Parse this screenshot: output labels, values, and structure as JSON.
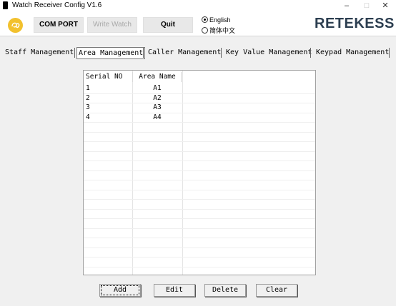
{
  "window": {
    "title": "Watch Receiver Config V1.6",
    "minimize": "–",
    "maximize": "□",
    "close": "✕"
  },
  "toolbar": {
    "com_port": "COM PORT",
    "write_watch": "Write Watch",
    "quit": "Quit",
    "language_options": [
      {
        "label": "English",
        "selected": true
      },
      {
        "label": "简体中文",
        "selected": false
      }
    ],
    "brand": "RETEKESS"
  },
  "tabs": [
    {
      "label": "Staff Management",
      "active": false
    },
    {
      "label": "Area Management",
      "active": true
    },
    {
      "label": "Caller Management",
      "active": false
    },
    {
      "label": "Key Value Management",
      "active": false
    },
    {
      "label": "Keypad Management",
      "active": false
    }
  ],
  "table": {
    "columns": [
      "Serial NO",
      "Area Name"
    ],
    "rows": [
      {
        "serial": "1",
        "name": "A1"
      },
      {
        "serial": "2",
        "name": "A2"
      },
      {
        "serial": "3",
        "name": "A3"
      },
      {
        "serial": "4",
        "name": "A4"
      }
    ]
  },
  "buttons": {
    "add": "Add",
    "edit": "Edit",
    "delete": "Delete",
    "clear": "Clear"
  },
  "colors": {
    "logo": "#f2c12e",
    "brand": "#2c3e50"
  }
}
